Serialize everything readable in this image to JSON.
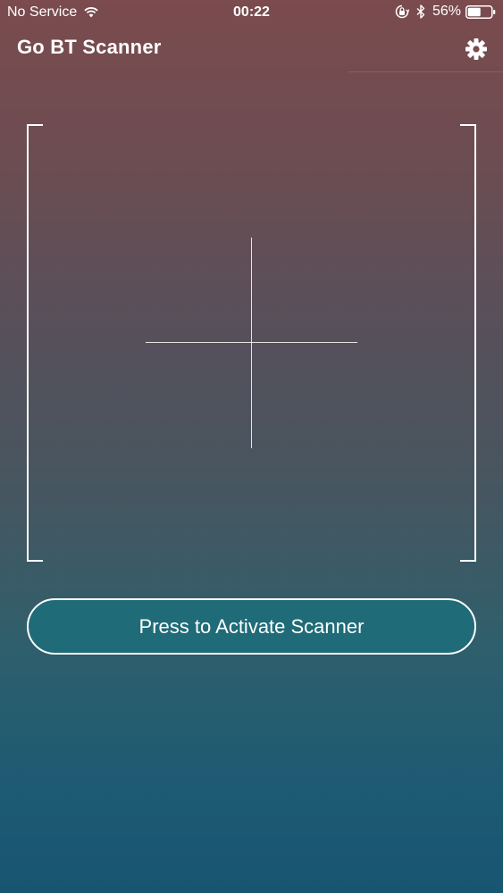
{
  "status_bar": {
    "carrier": "No Service",
    "time": "00:22",
    "battery_percent": "56%",
    "battery_level": 0.56,
    "icons": [
      "wifi-icon",
      "orientation-lock-icon",
      "bluetooth-icon",
      "battery-icon"
    ]
  },
  "header": {
    "title": "Go BT Scanner",
    "settings_icon": "gear-icon"
  },
  "scanner": {
    "activate_label": "Press to Activate Scanner"
  },
  "colors": {
    "gradient_top": "#7b4b4e",
    "gradient_bottom": "#185571",
    "button_fill": "#1f6b78",
    "foreground": "#ffffff"
  }
}
